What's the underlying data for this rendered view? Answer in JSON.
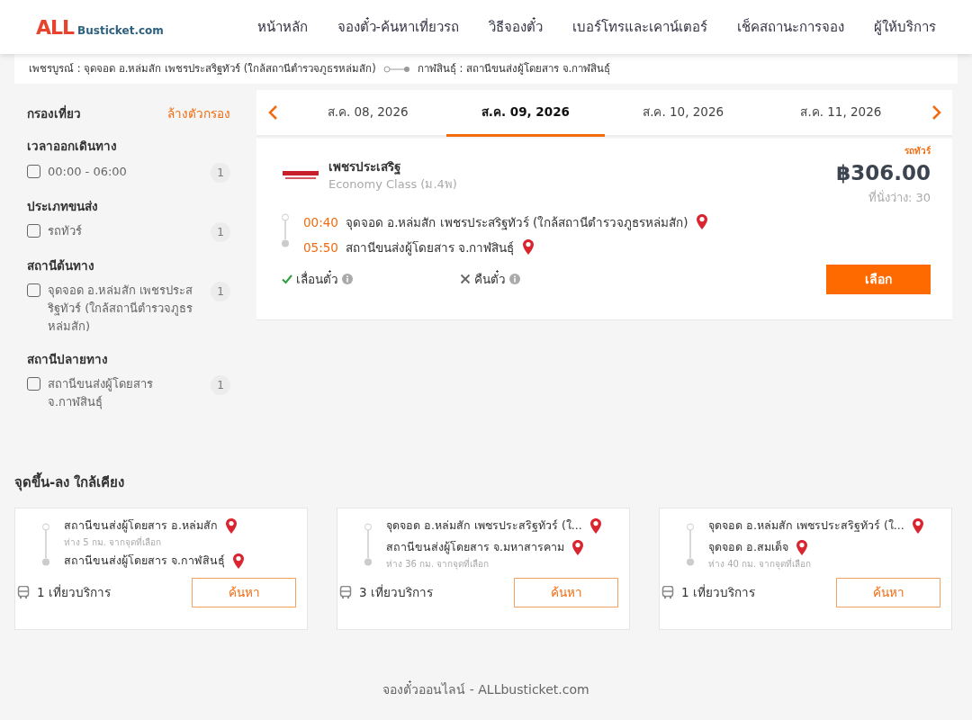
{
  "header": {
    "logo": {
      "accent": "ALL",
      "rest": "Busticket.com"
    },
    "menu": [
      "หน้าหลัก",
      "จองตั๋ว-ค้นหาเที่ยวรถ",
      "วิธีจองตั๋ว",
      "เบอร์โทรและเคาน์เตอร์",
      "เช็คสถานะการจอง",
      "ผู้ให้บริการ"
    ]
  },
  "route": {
    "origin": "เพชรบูรณ์ : จุดจอด อ.หล่มสัก เพชรประสริฐทัวร์ (ใกล้สถานีตำรวจภูธรหล่มสัก)",
    "destination": "กาฬสินธุ์ : สถานีขนส่งผู้โดยสาร จ.กาฬสินธุ์"
  },
  "filters": {
    "title": "กรองเที่ยว",
    "clear": "ล้างตัวกรอง",
    "groups": [
      {
        "title": "เวลาออกเดินทาง",
        "options": [
          {
            "label": "00:00 - 06:00",
            "count": "1",
            "checked": false
          }
        ]
      },
      {
        "title": "ประเภทขนส่ง",
        "options": [
          {
            "label": "รถทัวร์",
            "count": "1",
            "checked": false
          }
        ]
      },
      {
        "title": "สถานีต้นทาง",
        "options": [
          {
            "label": "จุดจอด อ.หล่มสัก เพชรประสริฐทัวร์ (ใกล้สถานีตำรวจภูธรหล่มสัก)",
            "count": "1",
            "checked": false
          }
        ]
      },
      {
        "title": "สถานีปลายทาง",
        "options": [
          {
            "label": "สถานีขนส่งผู้โดยสาร จ.กาฬสินธุ์",
            "count": "1",
            "checked": false
          }
        ]
      }
    ]
  },
  "dates": [
    {
      "label": "ส.ค. 08, 2026",
      "selected": false
    },
    {
      "label": "ส.ค. 09, 2026",
      "selected": true
    },
    {
      "label": "ส.ค. 10, 2026",
      "selected": false
    },
    {
      "label": "ส.ค. 11, 2026",
      "selected": false
    }
  ],
  "trip": {
    "type": "รถทัวร์",
    "operator": "เพชรประเสริฐ",
    "class": "Economy Class (ม.4พ)",
    "price": "฿306.00",
    "seats": "ที่นั่งว่าง: 30",
    "stops": [
      {
        "time": "00:40",
        "place": "จุดจอด อ.หล่มสัก เพชรประสริฐทัวร์ (ใกล้สถานีตำรวจภูธรหล่มสัก)"
      },
      {
        "time": "05:50",
        "place": "สถานีขนส่งผู้โดยสาร จ.กาฬสินธุ์"
      }
    ],
    "features": [
      {
        "label": "เลื่อนตั๋ว",
        "allowed": true
      },
      {
        "label": "คืนตั๋ว",
        "allowed": false
      }
    ],
    "button": "เลือก"
  },
  "nearby": {
    "title": "จุดขึ้น-ลง ใกล้เคียง",
    "cards": [
      {
        "stops": [
          {
            "place": "สถานีขนส่งผู้โดยสาร อ.หล่มสัก",
            "distance": "ห่าง 5 กม. จากจุดที่เลือก"
          },
          {
            "place": "สถานีขนส่งผู้โดยสาร จ.กาฬสินธุ์"
          }
        ],
        "trips": "1 เที่ยวบริการ",
        "button": "ค้นหา"
      },
      {
        "stops": [
          {
            "place": "จุดจอด อ.หล่มสัก เพชรประสริฐทัวร์ (ใ..."
          },
          {
            "place": "สถานีขนส่งผู้โดยสาร จ.มหาสารคาม",
            "distance": "ห่าง 36 กม. จากจุดที่เลือก"
          }
        ],
        "trips": "3 เที่ยวบริการ",
        "button": "ค้นหา"
      },
      {
        "stops": [
          {
            "place": "จุดจอด อ.หล่มสัก เพชรประสริฐทัวร์ (ใ..."
          },
          {
            "place": "จุดจอด อ.สมเด็จ",
            "distance": "ห่าง 40 กม. จากจุดที่เลือก"
          }
        ],
        "trips": "1 เที่ยวบริการ",
        "button": "ค้นหา"
      }
    ]
  },
  "footer": "จองตั๋วออนไลน์ - ALLbusticket.com"
}
